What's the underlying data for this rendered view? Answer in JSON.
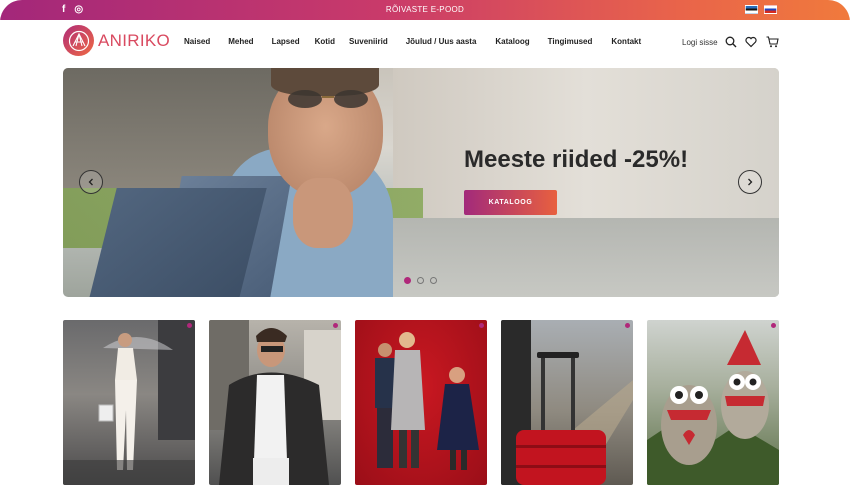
{
  "topbar": {
    "social": [
      {
        "icon": "facebook-icon",
        "glyph": "f"
      },
      {
        "icon": "instagram-icon",
        "glyph": "◎"
      }
    ],
    "tagline": "RÕIVASTE E-POOD",
    "languages": [
      {
        "code": "et",
        "icon": "estonia-flag-icon"
      },
      {
        "code": "ru",
        "icon": "russia-flag-icon"
      }
    ]
  },
  "header": {
    "logo_text": "ANIRIKO",
    "nav": [
      "Naised",
      "Mehed",
      "Lapsed",
      "Kotid",
      "Suveniirid",
      "Jõulud / Uus aasta",
      "Kataloog",
      "Tingimused",
      "Kontakt"
    ],
    "login": "Logi sisse",
    "icons": [
      "search-icon",
      "heart-icon",
      "cart-icon"
    ]
  },
  "hero": {
    "title": "Meeste riided -25%!",
    "button": "KATALOOG",
    "slides": 3,
    "active_slide": 1
  },
  "cards": [
    {
      "image": "woman-with-umbrella"
    },
    {
      "image": "man-in-leather-jacket"
    },
    {
      "image": "children-christmas"
    },
    {
      "image": "red-suitcase"
    },
    {
      "image": "christmas-owls"
    }
  ],
  "colors": {
    "accent_start": "#a3277a",
    "accent_end": "#f07a3c",
    "brand": "#d94a60"
  }
}
